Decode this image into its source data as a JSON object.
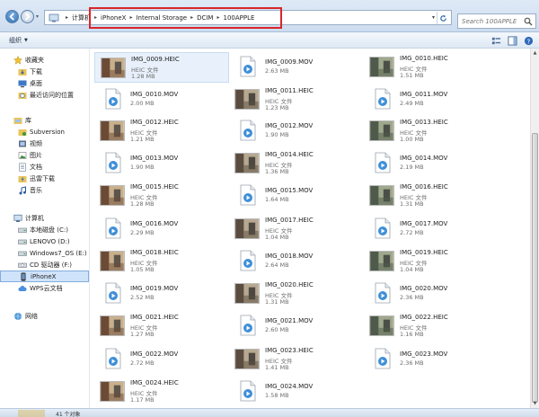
{
  "breadcrumb": [
    "计算机",
    "iPhoneX",
    "Internal Storage",
    "DCIM",
    "100APPLE"
  ],
  "search": {
    "placeholder": "Search 100APPLE"
  },
  "toolbar": {
    "organize_label": "组织"
  },
  "nav": {
    "favorites": {
      "label": "收藏夹",
      "items": [
        "下载",
        "桌面",
        "最近访问的位置"
      ]
    },
    "libraries": {
      "label": "库",
      "items": [
        "Subversion",
        "视频",
        "图片",
        "文档",
        "迅雷下载",
        "音乐"
      ]
    },
    "computer": {
      "label": "计算机",
      "items": [
        "本地磁盘 (C:)",
        "LENOVO (D:)",
        "Windows7_OS (E:)",
        "CD 驱动器 (F:)",
        "iPhoneX",
        "WPS云文档"
      ]
    },
    "network": {
      "label": "网络"
    }
  },
  "files": [
    {
      "name": "IMG_0009.HEIC",
      "type": "HEIC 文件",
      "size": "1.28 MB"
    },
    {
      "name": "IMG_0009.MOV",
      "size": "2.63 MB"
    },
    {
      "name": "IMG_0010.HEIC",
      "type": "HEIC 文件",
      "size": "1.51 MB"
    },
    {
      "name": "IMG_0010.MOV",
      "size": "2.00 MB"
    },
    {
      "name": "IMG_0011.HEIC",
      "type": "HEIC 文件",
      "size": "1.23 MB"
    },
    {
      "name": "IMG_0011.MOV",
      "size": "2.49 MB"
    },
    {
      "name": "IMG_0012.HEIC",
      "type": "HEIC 文件",
      "size": "1.21 MB"
    },
    {
      "name": "IMG_0012.MOV",
      "size": "1.90 MB"
    },
    {
      "name": "IMG_0013.HEIC",
      "type": "HEIC 文件",
      "size": "1.00 MB"
    },
    {
      "name": "IMG_0013.MOV",
      "size": "1.90 MB"
    },
    {
      "name": "IMG_0014.HEIC",
      "type": "HEIC 文件",
      "size": "1.36 MB"
    },
    {
      "name": "IMG_0014.MOV",
      "size": "2.19 MB"
    },
    {
      "name": "IMG_0015.HEIC",
      "type": "HEIC 文件",
      "size": "1.28 MB"
    },
    {
      "name": "IMG_0015.MOV",
      "size": "1.64 MB"
    },
    {
      "name": "IMG_0016.HEIC",
      "type": "HEIC 文件",
      "size": "1.31 MB"
    },
    {
      "name": "IMG_0016.MOV",
      "size": "2.29 MB"
    },
    {
      "name": "IMG_0017.HEIC",
      "type": "HEIC 文件",
      "size": "1.04 MB"
    },
    {
      "name": "IMG_0017.MOV",
      "size": "2.72 MB"
    },
    {
      "name": "IMG_0018.HEIC",
      "type": "HEIC 文件",
      "size": "1.05 MB"
    },
    {
      "name": "IMG_0018.MOV",
      "size": "2.64 MB"
    },
    {
      "name": "IMG_0019.HEIC",
      "type": "HEIC 文件",
      "size": "1.04 MB"
    },
    {
      "name": "IMG_0019.MOV",
      "size": "2.52 MB"
    },
    {
      "name": "IMG_0020.HEIC",
      "type": "HEIC 文件",
      "size": "1.31 MB"
    },
    {
      "name": "IMG_0020.MOV",
      "size": "2.36 MB"
    },
    {
      "name": "IMG_0021.HEIC",
      "type": "HEIC 文件",
      "size": "1.27 MB"
    },
    {
      "name": "IMG_0021.MOV",
      "size": "2.60 MB"
    },
    {
      "name": "IMG_0022.HEIC",
      "type": "HEIC 文件",
      "size": "1.16 MB"
    },
    {
      "name": "IMG_0022.MOV",
      "size": "2.72 MB"
    },
    {
      "name": "IMG_0023.HEIC",
      "type": "HEIC 文件",
      "size": "1.41 MB"
    },
    {
      "name": "IMG_0023.MOV",
      "size": "2.36 MB"
    },
    {
      "name": "IMG_0024.HEIC",
      "type": "HEIC 文件",
      "size": "1.17 MB"
    },
    {
      "name": "IMG_0024.MOV",
      "size": "1.58 MB"
    }
  ],
  "status": {
    "text": "41 个对象"
  },
  "colors": {
    "highlight": "#d9252a",
    "selected_bg": "#cfe3fa"
  }
}
